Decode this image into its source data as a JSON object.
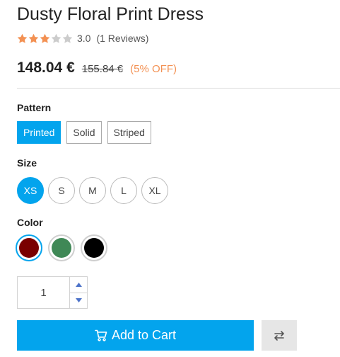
{
  "product": {
    "title": "Dusty Floral Print Dress",
    "rating": {
      "value": "3.0",
      "reviews_text": "(1 Reviews)",
      "stars_filled": 3,
      "stars_total": 5
    },
    "price": "148.04 €",
    "old_price": "155.84 €",
    "discount": "(5% OFF)"
  },
  "pattern": {
    "label": "Pattern",
    "options": [
      "Printed",
      "Solid",
      "Striped"
    ],
    "selected": "Printed"
  },
  "size": {
    "label": "Size",
    "options": [
      "XS",
      "S",
      "M",
      "L",
      "XL"
    ],
    "selected": "XS"
  },
  "color": {
    "label": "Color",
    "options": [
      "#7a0000",
      "#3f8856",
      "#000000"
    ],
    "selected_index": 0
  },
  "quantity": {
    "value": "1"
  },
  "actions": {
    "add_to_cart_label": "Add to Cart",
    "compare_icon": "compare-arrows-icon"
  },
  "colors": {
    "accent": "#03a4ed",
    "discount": "#f39153",
    "star_filled": "#f39153",
    "star_empty": "#cccccc"
  }
}
